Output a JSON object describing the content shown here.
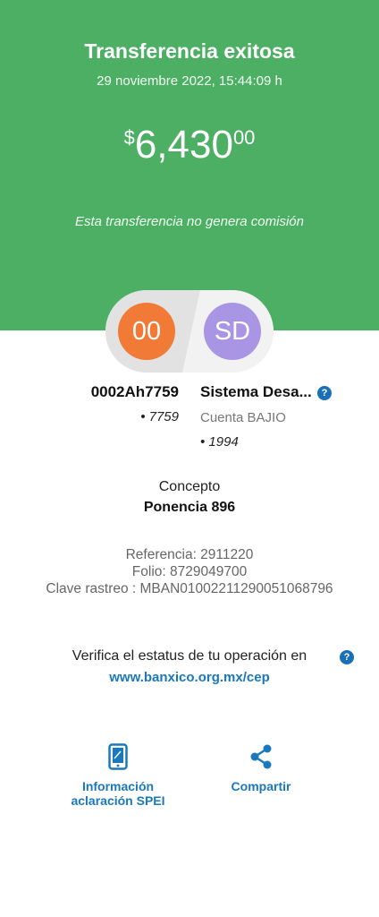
{
  "header": {
    "title": "Transferencia exitosa",
    "datetime": "29 noviembre 2022, 15:44:09 h",
    "amount_symbol": "$",
    "amount_main": "6,430",
    "amount_cents": "00",
    "fee_note": "Esta transferencia no genera comisión",
    "bg_color": "#4caf63"
  },
  "origin": {
    "initials": "00",
    "name": "0002Ah7759",
    "last_digits": "• 7759",
    "color": "#f07a36"
  },
  "destination": {
    "initials": "SD",
    "name": "Sistema Desa...",
    "bank": "Cuenta BAJIO",
    "last_digits": "• 1994",
    "color": "#a895e4",
    "help_icon": "question-icon"
  },
  "concept": {
    "label": "Concepto",
    "value": "Ponencia 896"
  },
  "references": {
    "referencia": "Referencia: 2911220",
    "folio": "Folio: 8729049700",
    "clave_rastreo": "Clave rastreo : MBAN01002211290051068796"
  },
  "verify": {
    "text": "Verifica el estatus de tu operación en",
    "link": "www.banxico.org.mx/cep",
    "help_icon": "question-icon"
  },
  "actions": {
    "info": {
      "line1": "Información",
      "line2": "aclaración SPEI",
      "icon": "phone-icon"
    },
    "share": {
      "label": "Compartir",
      "icon": "share-icon"
    }
  }
}
